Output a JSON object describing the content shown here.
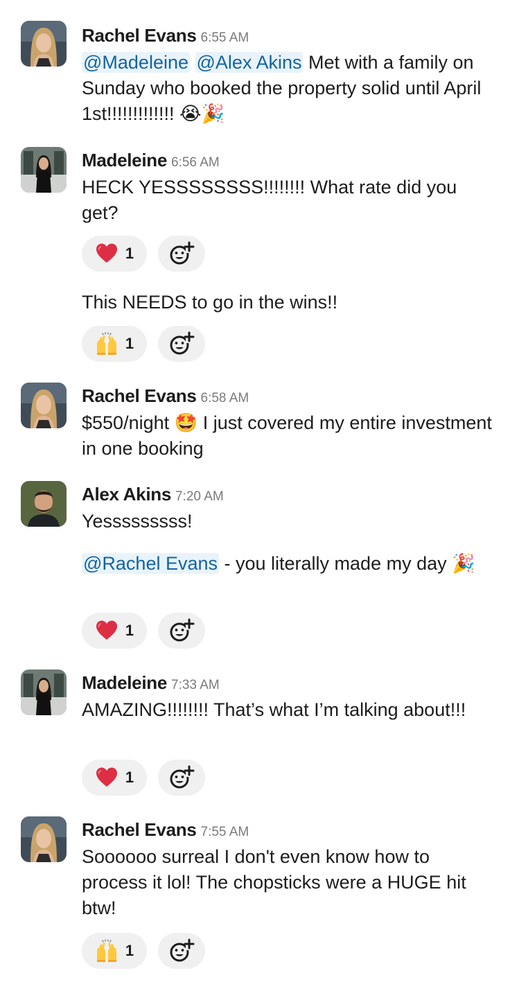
{
  "messages": [
    {
      "author": "Rachel Evans",
      "time": "6:55 AM",
      "avatar": "rachel-avatar",
      "mentions": [
        "@Madeleine",
        "@Alex Akins"
      ],
      "text_after_mentions": " Met with a family on Sunday who booked the property solid until April 1st!!!!!!!!!!!!! ",
      "emojis": [
        "😭",
        "🎉"
      ]
    },
    {
      "author": "Madeleine",
      "time": "6:56 AM",
      "avatar": "madeleine-avatar",
      "text": "HECK YESSSSSSSS!!!!!!!! What rate did you get?",
      "reaction": {
        "emoji": "heart",
        "count": "1"
      },
      "followup_text": "This NEEDS to go in the wins!!",
      "followup_reaction": {
        "emoji": "raised-hands",
        "count": "1"
      }
    },
    {
      "author": "Rachel Evans",
      "time": "6:58 AM",
      "avatar": "rachel-avatar",
      "text_before_emoji": "$550/night ",
      "emoji": "🤩",
      "text_after_emoji": " I just covered my entire investment in one booking"
    },
    {
      "author": "Alex Akins",
      "time": "7:20 AM",
      "avatar": "alex-avatar",
      "text": "Yesssssssss!",
      "followup_mention": "@Rachel Evans",
      "followup_text": " - you literally made my day ",
      "followup_emoji": "🎉",
      "reaction": {
        "emoji": "heart",
        "count": "1"
      }
    },
    {
      "author": "Madeleine",
      "time": "7:33 AM",
      "avatar": "madeleine-avatar",
      "text": "AMAZING!!!!!!!! That’s what I’m talking about!!!",
      "reaction": {
        "emoji": "heart",
        "count": "1"
      }
    },
    {
      "author": "Rachel Evans",
      "time": "7:55 AM",
      "avatar": "rachel-avatar",
      "text": "Soooooo surreal I don't even know how to process it lol! The chopsticks were a HUGE hit btw!",
      "reaction": {
        "emoji": "raised-hands",
        "count": "1"
      }
    }
  ],
  "colors": {
    "mention_text": "#1264a3",
    "mention_bg": "#e8f3fb",
    "reaction_bg": "#f0f0f1",
    "timestamp": "#7a7a7a"
  },
  "icons": {
    "add_reaction": "add-emoji-icon",
    "heart": "heart-icon",
    "raised_hands": "raised-hands-icon"
  }
}
